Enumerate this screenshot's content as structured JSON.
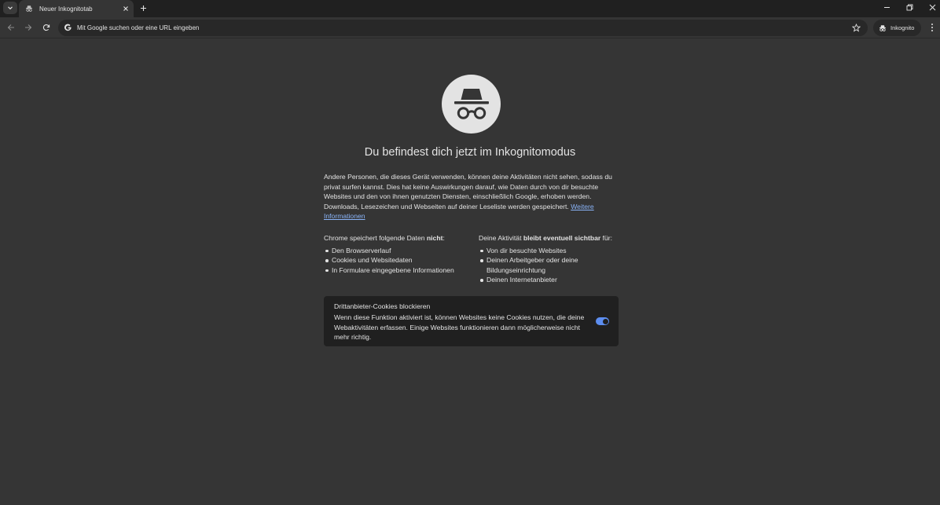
{
  "tab": {
    "title": "Neuer Inkognitotab"
  },
  "omnibox": {
    "placeholder": "Mit Google suchen oder eine URL eingeben"
  },
  "profile": {
    "label": "Inkognito"
  },
  "content": {
    "headline": "Du befindest dich jetzt im Inkognitomodus",
    "intro": "Andere Personen, die dieses Gerät verwenden, können deine Aktivitäten nicht sehen, sodass du privat surfen kannst. Dies hat keine Auswirkungen darauf, wie Daten durch von dir besuchte Websites und den von ihnen genutzten Diensten, einschließlich Google, erhoben werden. Downloads, Lesezeichen und Webseiten auf deiner Leseliste werden gespeichert.",
    "learn_more": "Weitere Informationen",
    "left_heading_pre": "Chrome speichert folgende Daten ",
    "left_heading_bold": "nicht",
    "left_heading_post": ":",
    "left_items": [
      "Den Browserverlauf",
      "Cookies und Websitedaten",
      "In Formulare eingegebene Informationen"
    ],
    "right_heading_pre": "Deine Aktivität ",
    "right_heading_bold": "bleibt eventuell sichtbar",
    "right_heading_post": " für:",
    "right_items": [
      "Von dir besuchte Websites",
      "Deinen Arbeitgeber oder deine Bildungseinrichtung",
      "Deinen Internetanbieter"
    ]
  },
  "cookies": {
    "title": "Drittanbieter-Cookies blockieren",
    "description": "Wenn diese Funktion aktiviert ist, können Websites keine Cookies nutzen, die deine Webaktivitäten erfassen. Einige Websites funktionieren dann möglicherweise nicht mehr richtig.",
    "enabled": true
  },
  "colors": {
    "page_bg": "#353535",
    "frame_bg": "#202020",
    "link": "#8ab4f8",
    "toggle_on": "#5d8ef0"
  }
}
